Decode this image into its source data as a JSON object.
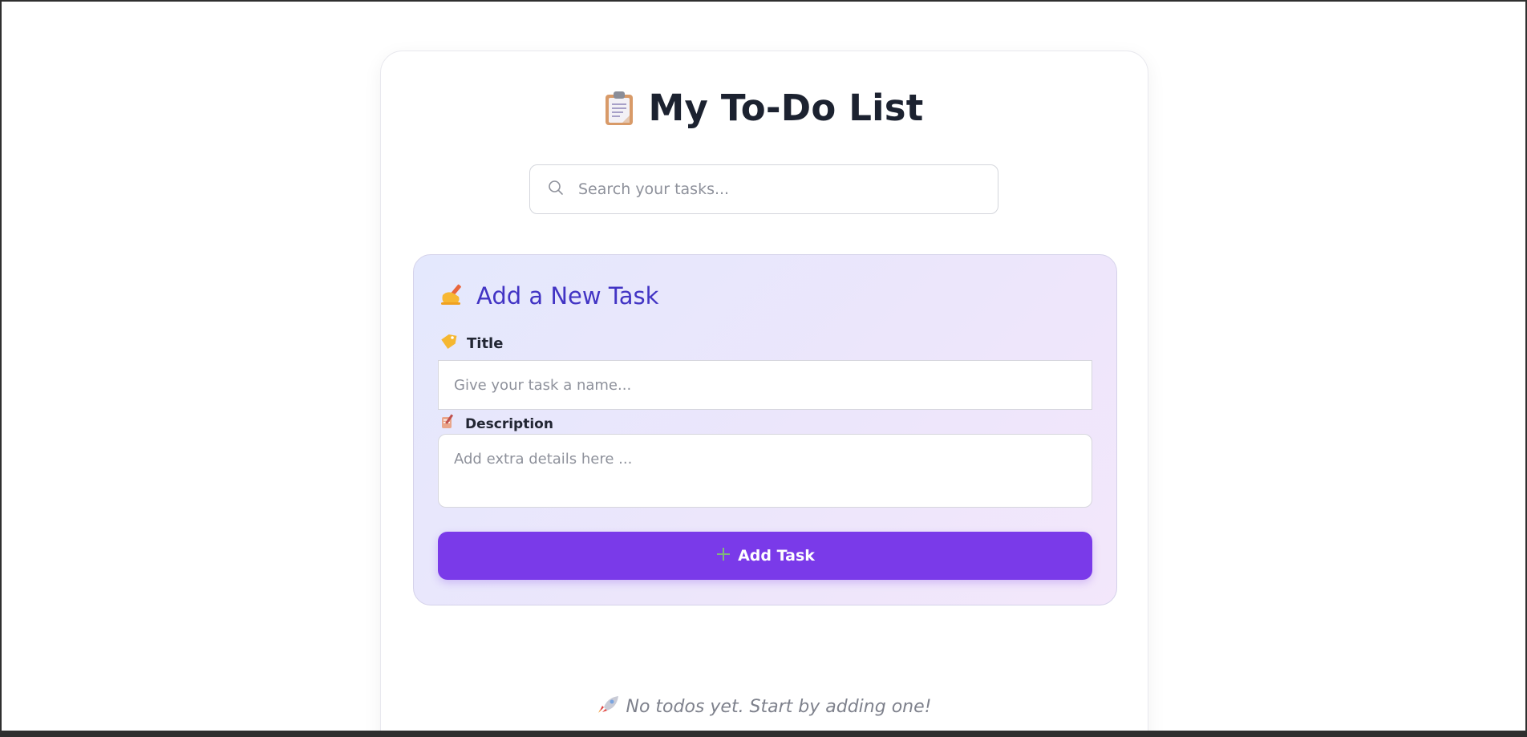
{
  "header": {
    "title": "My To-Do List",
    "icon": "clipboard-icon"
  },
  "search": {
    "placeholder": "Search your tasks...",
    "icon": "search-icon"
  },
  "add_task_panel": {
    "heading": "Add a New Task",
    "heading_icon": "writing-hand-icon",
    "title_label": "Title",
    "title_icon": "tag-icon",
    "title_placeholder": "Give your task a name...",
    "description_label": "Description",
    "description_icon": "memo-icon",
    "description_placeholder": "Add extra details here ...",
    "button_label": "Add Task",
    "button_icon": "plus-icon",
    "accent_color": "#7a3ae9",
    "heading_color": "#4234c4"
  },
  "empty_state": {
    "message": "No todos yet. Start by adding one!",
    "icon": "rocket-icon"
  }
}
